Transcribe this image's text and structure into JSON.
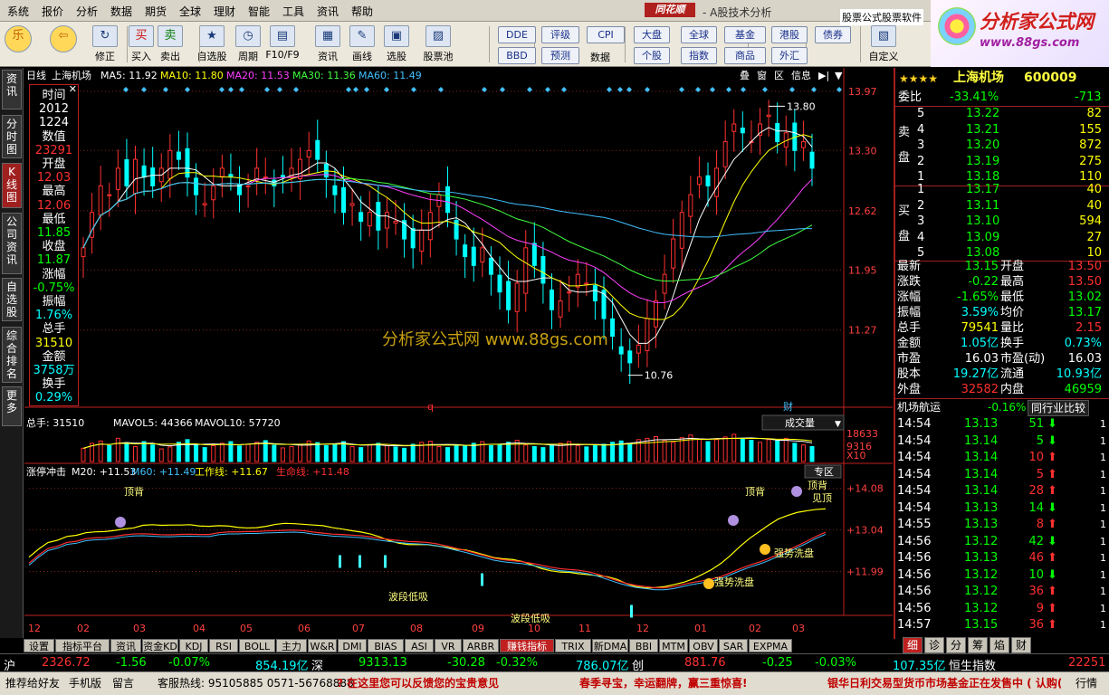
{
  "menu": [
    "系统",
    "报价",
    "分析",
    "数据",
    "期货",
    "全球",
    "理财",
    "智能",
    "工具",
    "资讯",
    "帮助"
  ],
  "brand": "同花顺",
  "menu_title": "- A股技术分析",
  "toolbar": {
    "buttons": [
      {
        "label": "",
        "icon": "lotus-icon"
      },
      {
        "label": "",
        "icon": "back-arrow-icon"
      },
      {
        "label": "修正",
        "icon": "refresh-icon"
      },
      {
        "label": "买入",
        "icon": "buy-icon",
        "glyph": "买"
      },
      {
        "label": "卖出",
        "icon": "sell-icon",
        "glyph": "卖"
      },
      {
        "label": "自选股",
        "icon": "star-icon"
      },
      {
        "label": "周期",
        "icon": "clock-icon"
      },
      {
        "label": "F10/F9",
        "icon": "f10-icon"
      },
      {
        "label": "资讯",
        "icon": "news-icon"
      },
      {
        "label": "画线",
        "icon": "pen-icon"
      },
      {
        "label": "选股",
        "icon": "select-icon"
      },
      {
        "label": "股票池",
        "icon": "chart-icon"
      }
    ],
    "small_buttons": [
      "DDE",
      "BBD",
      "评级",
      "预测",
      "CPI"
    ],
    "small_caption": "数据",
    "market_buttons": [
      "大盘",
      "全球",
      "基金",
      "港股",
      "债券",
      "个股",
      "指数",
      "商品",
      "外汇"
    ],
    "custom_label": "自定义",
    "ad_text": "股票公式股票软件"
  },
  "logo": {
    "title": "分析家公式网",
    "url": "www.88gs.com"
  },
  "sidetabs": [
    "资讯",
    "分时图",
    "K线图",
    "公司资讯",
    "自选股",
    "综合排名",
    "更多"
  ],
  "chart": {
    "period_label": "日线",
    "stock_name": "上海机场",
    "ma": [
      {
        "label": "MA5",
        "value": "11.92",
        "color": "#ffffff"
      },
      {
        "label": "MA10",
        "value": "11.80",
        "color": "#ffff00"
      },
      {
        "label": "MA20",
        "value": "11.53",
        "color": "#ff40ff"
      },
      {
        "label": "MA30",
        "value": "11.36",
        "color": "#40ff40"
      },
      {
        "label": "MA60",
        "value": "11.49",
        "color": "#40c0ff"
      }
    ],
    "header_buttons": [
      "叠",
      "窗",
      "区",
      "信息"
    ],
    "price_axis": [
      "13.97",
      "13.30",
      "12.62",
      "11.95",
      "11.27"
    ],
    "high_mark": "13.80",
    "low_mark": "10.76",
    "markers": [
      "q",
      "财"
    ],
    "watermark": "分析家公式网 www.88gs.com",
    "price_range": [
      10.5,
      14.05
    ],
    "closes": [
      12.2,
      12.6,
      12.9,
      12.8,
      13.1,
      12.9,
      13.2,
      13.0,
      12.9,
      13.1,
      13.3,
      13.2,
      13.0,
      12.8,
      12.7,
      12.9,
      13.1,
      13.0,
      12.8,
      12.9,
      13.1,
      13.0,
      12.9,
      13.0,
      13.1,
      13.2,
      13.3,
      13.2,
      13.0,
      12.8,
      12.6,
      12.7,
      12.5,
      12.6,
      12.4,
      12.6,
      12.5,
      12.3,
      12.2,
      12.4,
      12.6,
      12.8,
      12.6,
      12.3,
      12.1,
      12.0,
      12.2,
      11.9,
      11.7,
      11.5,
      11.8,
      12.2,
      12.0,
      11.8,
      11.5,
      11.6,
      11.7,
      11.9,
      11.8,
      11.6,
      11.4,
      11.2,
      11.0,
      10.9,
      11.1,
      11.4,
      11.6,
      11.9,
      12.3,
      12.6,
      12.8,
      13.0,
      12.9,
      13.1,
      13.4,
      13.6,
      13.5,
      13.4,
      13.6,
      13.7,
      13.4,
      13.5,
      13.3,
      13.4,
      13.1
    ],
    "volume": {
      "label_total": "总手: 31510",
      "mavol5": "MAVOL5: 44366",
      "mavol10": "MAVOL10: 57720",
      "dropdown": "成交量",
      "axis": [
        "18633",
        "9316",
        "X10"
      ],
      "values": [
        40,
        55,
        62,
        48,
        70,
        52,
        45,
        60,
        50,
        38,
        44,
        58,
        66,
        50,
        42,
        48,
        55,
        60,
        47,
        52,
        58,
        63,
        49,
        41,
        45,
        50,
        62,
        57,
        48,
        52,
        60,
        45,
        42,
        50,
        55,
        48,
        44,
        40,
        52,
        58,
        61,
        45,
        42,
        50,
        47,
        55,
        60,
        48,
        52,
        58,
        64,
        50,
        45,
        42,
        48,
        55,
        60,
        48,
        44,
        50,
        52,
        58,
        62,
        54,
        66,
        70,
        75,
        64,
        58,
        72,
        80,
        68,
        60,
        66,
        74,
        82,
        70,
        64,
        58,
        66,
        62,
        70,
        55,
        50,
        45
      ]
    },
    "indicator": {
      "name": "涨停冲击",
      "m20": "M20: +11.53",
      "m60": "M60: +11.49",
      "work": "工作线: +11.67",
      "life": "生命线: +11.48",
      "zone_btn": "专区",
      "axis": [
        "+14.08",
        "+13.04",
        "+11.99"
      ],
      "labels": [
        "顶背",
        "顶背",
        "顶背",
        "见顶",
        "强势洗盘",
        "强势洗盘",
        "波段低吸",
        "波段低吸"
      ]
    },
    "x_axis": [
      "12",
      "02",
      "03",
      "04",
      "05",
      "06",
      "07",
      "08",
      "09",
      "10",
      "11",
      "12",
      "01",
      "02",
      "03"
    ]
  },
  "quote": {
    "stars": "★★★★",
    "name": "上海机场",
    "code": "600009",
    "weibi_label": "委比",
    "weibi": "-33.41%",
    "weicha": "-713",
    "sell_label": "卖盘",
    "buy_label": "买盘",
    "sell": [
      {
        "lvl": "5",
        "price": "13.22",
        "vol": "82"
      },
      {
        "lvl": "4",
        "price": "13.21",
        "vol": "155"
      },
      {
        "lvl": "3",
        "price": "13.20",
        "vol": "872"
      },
      {
        "lvl": "2",
        "price": "13.19",
        "vol": "275"
      },
      {
        "lvl": "1",
        "price": "13.18",
        "vol": "110"
      }
    ],
    "buy": [
      {
        "lvl": "1",
        "price": "13.17",
        "vol": "40"
      },
      {
        "lvl": "2",
        "price": "13.11",
        "vol": "40"
      },
      {
        "lvl": "3",
        "price": "13.10",
        "vol": "594"
      },
      {
        "lvl": "4",
        "price": "13.09",
        "vol": "27"
      },
      {
        "lvl": "5",
        "price": "13.08",
        "vol": "10"
      }
    ],
    "stats": [
      {
        "l1": "最新",
        "v1": "13.15",
        "c1": "#00ff00",
        "l2": "开盘",
        "v2": "13.50",
        "c2": "#ff3030"
      },
      {
        "l1": "涨跌",
        "v1": "-0.22",
        "c1": "#00ff00",
        "l2": "最高",
        "v2": "13.50",
        "c2": "#ff3030"
      },
      {
        "l1": "涨幅",
        "v1": "-1.65%",
        "c1": "#00ff00",
        "l2": "最低",
        "v2": "13.02",
        "c2": "#00ff00"
      },
      {
        "l1": "振幅",
        "v1": "3.59%",
        "c1": "#00ffff",
        "l2": "均价",
        "v2": "13.17",
        "c2": "#00ff00"
      },
      {
        "l1": "总手",
        "v1": "79541",
        "c1": "#ffff00",
        "l2": "量比",
        "v2": "2.15",
        "c2": "#ff3030"
      },
      {
        "l1": "金额",
        "v1": "1.05亿",
        "c1": "#00ffff",
        "l2": "换手",
        "v2": "0.73%",
        "c2": "#00ffff"
      },
      {
        "l1": "市盈",
        "v1": "16.03",
        "c1": "#ffffff",
        "l2": "市盈(动)",
        "v2": "16.03",
        "c2": "#ffffff"
      },
      {
        "l1": "股本",
        "v1": "19.27亿",
        "c1": "#00ffff",
        "l2": "流通",
        "v2": "10.93亿",
        "c2": "#00ffff"
      },
      {
        "l1": "外盘",
        "v1": "32582",
        "c1": "#ff3030",
        "l2": "内盘",
        "v2": "46959",
        "c2": "#00ff00"
      }
    ],
    "industry": "机场航运",
    "industry_chg": "-0.16%",
    "compare_btn": "同行业比较",
    "ticks": [
      {
        "t": "14:54",
        "p": "13.13",
        "v": "51",
        "dir": "down"
      },
      {
        "t": "14:54",
        "p": "13.14",
        "v": "5",
        "dir": "down"
      },
      {
        "t": "14:54",
        "p": "13.14",
        "v": "10",
        "dir": "up"
      },
      {
        "t": "14:54",
        "p": "13.14",
        "v": "5",
        "dir": "up"
      },
      {
        "t": "14:54",
        "p": "13.14",
        "v": "28",
        "dir": "up"
      },
      {
        "t": "14:54",
        "p": "13.13",
        "v": "14",
        "dir": "down"
      },
      {
        "t": "14:55",
        "p": "13.13",
        "v": "8",
        "dir": "up"
      },
      {
        "t": "14:56",
        "p": "13.12",
        "v": "42",
        "dir": "down"
      },
      {
        "t": "14:56",
        "p": "13.13",
        "v": "46",
        "dir": "up"
      },
      {
        "t": "14:56",
        "p": "13.12",
        "v": "10",
        "dir": "down"
      },
      {
        "t": "14:56",
        "p": "13.12",
        "v": "36",
        "dir": "up"
      },
      {
        "t": "14:56",
        "p": "13.12",
        "v": "9",
        "dir": "up"
      },
      {
        "t": "14:57",
        "p": "13.15",
        "v": "36",
        "dir": "up"
      }
    ],
    "tabs": [
      "细",
      "诊",
      "分",
      "筹",
      "焰",
      "财"
    ]
  },
  "datawin": [
    {
      "t": "时间",
      "c": "#ffffff"
    },
    {
      "t": "2012",
      "c": "#ffffff"
    },
    {
      "t": "1224",
      "c": "#ffffff"
    },
    {
      "t": "数值",
      "c": "#ffffff"
    },
    {
      "t": "23291",
      "c": "#ff3030"
    },
    {
      "t": "开盘",
      "c": "#ffffff"
    },
    {
      "t": "12.03",
      "c": "#ff3030"
    },
    {
      "t": "最高",
      "c": "#ffffff"
    },
    {
      "t": "12.06",
      "c": "#ff3030"
    },
    {
      "t": "最低",
      "c": "#ffffff"
    },
    {
      "t": "11.85",
      "c": "#00ff00"
    },
    {
      "t": "收盘",
      "c": "#ffffff"
    },
    {
      "t": "11.87",
      "c": "#00ff00"
    },
    {
      "t": "涨幅",
      "c": "#ffffff"
    },
    {
      "t": "-0.75%",
      "c": "#00ff00"
    },
    {
      "t": "振幅",
      "c": "#ffffff"
    },
    {
      "t": "1.76%",
      "c": "#00ffff"
    },
    {
      "t": "总手",
      "c": "#ffffff"
    },
    {
      "t": "31510",
      "c": "#ffff00"
    },
    {
      "t": "金额",
      "c": "#ffffff"
    },
    {
      "t": "3758万",
      "c": "#00ffff"
    },
    {
      "t": "换手",
      "c": "#ffffff"
    },
    {
      "t": "0.29%",
      "c": "#00ffff"
    }
  ],
  "bottom_tabs": [
    "设置",
    "指标平台",
    "资讯",
    "资金KD",
    "KDJ",
    "RSI",
    "BOLL",
    "主力",
    "W&R",
    "DMI",
    "BIAS",
    "ASI",
    "VR",
    "ARBR",
    "赚钱指标",
    "TRIX",
    "新DMA",
    "BBI",
    "MTM",
    "OBV",
    "SAR",
    "EXPMA"
  ],
  "status": {
    "sh_label": "沪",
    "sh_val": "2326.72",
    "sh_chg": "-1.56",
    "sh_pct": "-0.07%",
    "sh_amt": "854.19亿",
    "sz_label": "深",
    "sz_val": "9313.13",
    "sz_chg": "-30.28",
    "sz_pct": "-0.32%",
    "sz_amt": "786.07亿",
    "cy_label": "创",
    "cy_val": "881.76",
    "cy_chg": "-0.25",
    "cy_pct": "-0.03%",
    "cy_amt": "107.35亿",
    "hs_label": "恒生指数",
    "hs_val": "22251"
  },
  "footer": {
    "recommend": "推荐给好友",
    "mobile": "手机版",
    "message": "留言",
    "hotline": "客服热线: 95105885  0571-56768888",
    "feedback": "? 在这里您可以反馈您的宝贵意见",
    "promo": "春季寻宝，幸运翻牌，赢三重惊喜!",
    "news": "银华日利交易型货币市场基金正在发售中 ( 认购(",
    "quote_btn": "行情"
  }
}
